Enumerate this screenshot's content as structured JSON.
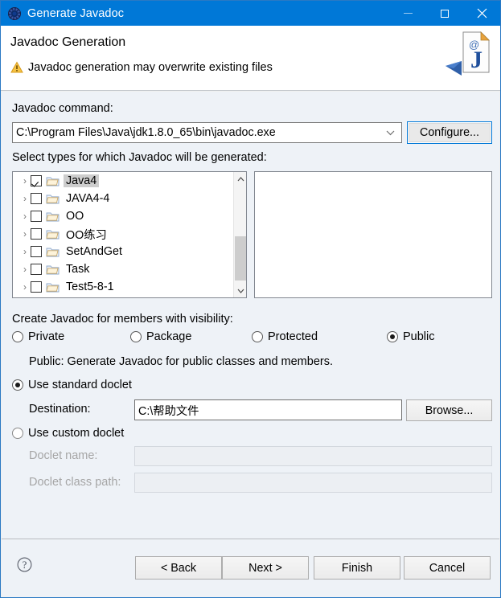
{
  "window": {
    "title": "Generate Javadoc",
    "title_icon": "gear-icon",
    "controls": {
      "minimize": "minimize-icon",
      "maximize": "maximize-icon",
      "close": "close-icon"
    },
    "titlebar_color": "#0078d7"
  },
  "header": {
    "title": "Javadoc Generation",
    "warning_icon": "warning-triangle-icon",
    "warning_text": "Javadoc generation may overwrite existing files",
    "banner_icon": "javadoc-page-icon"
  },
  "command": {
    "label": "Javadoc command:",
    "value": "C:\\Program Files\\Java\\jdk1.8.0_65\\bin\\javadoc.exe",
    "dropdown_icon": "chevron-down-icon",
    "configure_button": "Configure..."
  },
  "types": {
    "label": "Select types for which Javadoc will be generated:",
    "tree": [
      {
        "label": "Java4",
        "checked": true,
        "selected": true,
        "expander": "chevron-right-icon",
        "icon": "folder-icon"
      },
      {
        "label": "JAVA4-4",
        "checked": false,
        "selected": false,
        "expander": "chevron-right-icon",
        "icon": "folder-icon"
      },
      {
        "label": "OO",
        "checked": false,
        "selected": false,
        "expander": "chevron-right-icon",
        "icon": "folder-icon"
      },
      {
        "label": "OO练习",
        "checked": false,
        "selected": false,
        "expander": "chevron-right-icon",
        "icon": "folder-icon"
      },
      {
        "label": "SetAndGet",
        "checked": false,
        "selected": false,
        "expander": "chevron-right-icon",
        "icon": "folder-icon"
      },
      {
        "label": "Task",
        "checked": false,
        "selected": false,
        "expander": "chevron-right-icon",
        "icon": "folder-icon"
      },
      {
        "label": "Test5-8-1",
        "checked": false,
        "selected": false,
        "expander": "chevron-right-icon",
        "icon": "folder-icon"
      }
    ],
    "scrollbar": {
      "up_icon": "scroll-up-arrow-icon",
      "down_icon": "scroll-down-arrow-icon"
    },
    "members_list": []
  },
  "visibility": {
    "label": "Create Javadoc for members with visibility:",
    "options": [
      {
        "label": "Private",
        "selected": false
      },
      {
        "label": "Package",
        "selected": false
      },
      {
        "label": "Protected",
        "selected": false
      },
      {
        "label": "Public",
        "selected": true
      }
    ],
    "description": "Public: Generate Javadoc for public classes and members."
  },
  "doclet": {
    "standard": {
      "label": "Use standard doclet",
      "selected": true
    },
    "destination": {
      "label": "Destination:",
      "value": "C:\\帮助文件",
      "browse_button": "Browse..."
    },
    "custom": {
      "label": "Use custom doclet",
      "selected": false
    },
    "doclet_name": {
      "label": "Doclet name:",
      "value": "",
      "enabled": false
    },
    "doclet_class_path": {
      "label": "Doclet class path:",
      "value": "",
      "enabled": false
    }
  },
  "footer": {
    "help_icon": "help-question-icon",
    "buttons": {
      "back": "< Back",
      "next": "Next >",
      "finish": "Finish",
      "cancel": "Cancel"
    }
  }
}
